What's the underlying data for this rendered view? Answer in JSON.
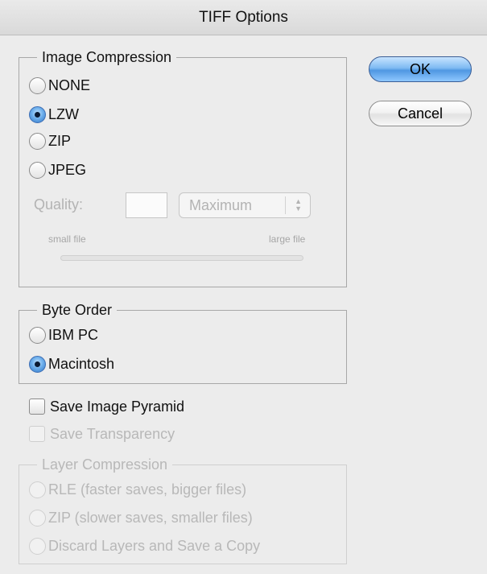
{
  "title": "TIFF Options",
  "buttons": {
    "ok": "OK",
    "cancel": "Cancel"
  },
  "image_compression": {
    "legend": "Image Compression",
    "options": [
      "NONE",
      "LZW",
      "ZIP",
      "JPEG"
    ],
    "selected": "LZW",
    "quality_label": "Quality:",
    "quality_value": "",
    "quality_select": "Maximum",
    "small_file": "small file",
    "large_file": "large file"
  },
  "byte_order": {
    "legend": "Byte Order",
    "options": [
      "IBM PC",
      "Macintosh"
    ],
    "selected": "Macintosh"
  },
  "checkboxes": {
    "save_image_pyramid": "Save Image Pyramid",
    "save_transparency": "Save Transparency"
  },
  "layer_compression": {
    "legend": "Layer Compression",
    "options": [
      "RLE (faster saves, bigger files)",
      "ZIP (slower saves, smaller files)",
      "Discard Layers and Save a Copy"
    ]
  }
}
